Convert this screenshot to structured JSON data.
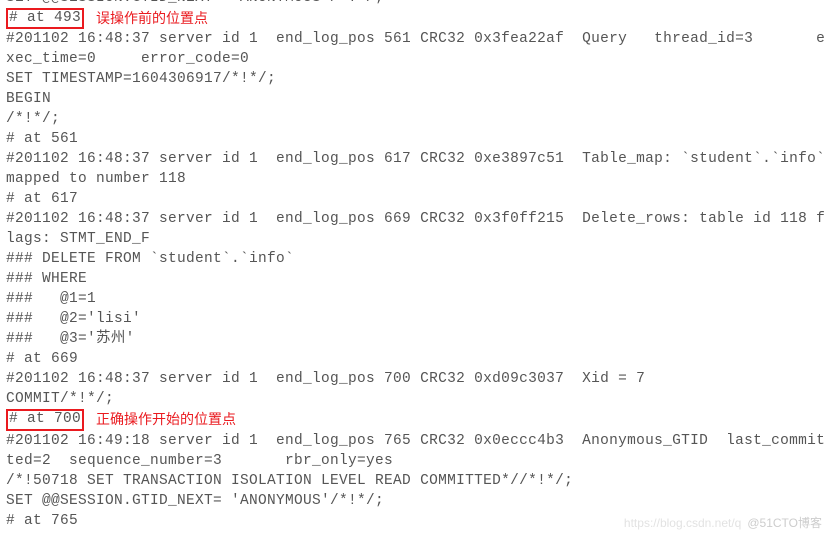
{
  "line_cut_top": "SET @@SESSION.GTID_NEXT= 'ANONYMOUS'/*!*/;",
  "pos1_box": "# at 493",
  "annotation1": "误操作前的位置点",
  "block1": "#201102 16:48:37 server id 1  end_log_pos 561 CRC32 0x3fea22af  Query   thread_id=3       exec_time=0     error_code=0\nSET TIMESTAMP=1604306917/*!*/;\nBEGIN\n/*!*/;\n# at 561\n#201102 16:48:37 server id 1  end_log_pos 617 CRC32 0xe3897c51  Table_map: `student`.`info` mapped to number 118\n# at 617\n#201102 16:48:37 server id 1  end_log_pos 669 CRC32 0x3f0ff215  Delete_rows: table id 118 flags: STMT_END_F\n### DELETE FROM `student`.`info`\n### WHERE\n###   @1=1\n###   @2='lisi'\n###   @3='苏州'\n# at 669\n#201102 16:48:37 server id 1  end_log_pos 700 CRC32 0xd09c3037  Xid = 7\nCOMMIT/*!*/;",
  "pos2_box": "# at 700",
  "annotation2": "正确操作开始的位置点",
  "block2": "#201102 16:49:18 server id 1  end_log_pos 765 CRC32 0x0eccc4b3  Anonymous_GTID  last_committed=2  sequence_number=3       rbr_only=yes\n/*!50718 SET TRANSACTION ISOLATION LEVEL READ COMMITTED*//*!*/;\nSET @@SESSION.GTID_NEXT= 'ANONYMOUS'/*!*/;\n# at 765",
  "watermark_left": "https://blog.csdn.net/q",
  "watermark_right": "@51CTO博客"
}
